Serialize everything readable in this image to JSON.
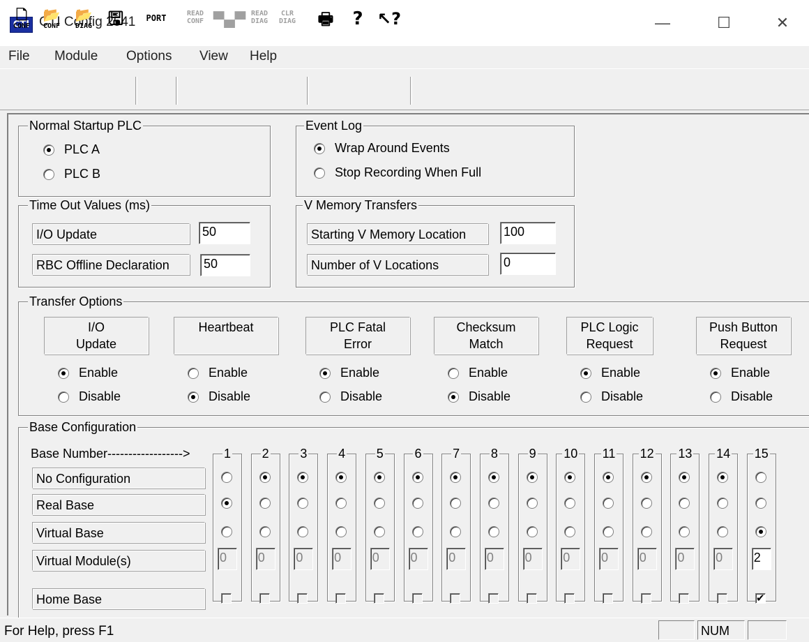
{
  "window": {
    "title": "CTI Config 2541",
    "icon_text": "CTI",
    "minimize": "—",
    "maximize": "☐",
    "close": "✕"
  },
  "menu": [
    "File",
    "Module",
    "Options",
    "View",
    "Help"
  ],
  "toolbar": {
    "new_conf": "CONF",
    "open_conf": "CONF",
    "open_diag": "DIAG",
    "port": "PORT",
    "read_conf": [
      "READ",
      "CONF"
    ],
    "read_diag": [
      "READ",
      "DIAG"
    ],
    "clr_diag": [
      "CLR",
      "DIAG"
    ]
  },
  "startup": {
    "title": "Normal Startup PLC",
    "options": [
      "PLC A",
      "PLC B"
    ],
    "selected": 0
  },
  "eventlog": {
    "title": "Event Log",
    "options": [
      "Wrap Around Events",
      "Stop Recording When Full"
    ],
    "selected": 0
  },
  "timeouts": {
    "title": "Time Out Values (ms)",
    "io_label": "I/O Update",
    "io_value": "50",
    "rbc_label": "RBC Offline Declaration",
    "rbc_value": "50"
  },
  "vmem": {
    "title": "V Memory Transfers",
    "start_label": "Starting V Memory Location",
    "start_value": "100",
    "count_label": "Number of V Locations",
    "count_value": "0"
  },
  "transfer": {
    "title": "Transfer Options",
    "enable": "Enable",
    "disable": "Disable",
    "options": [
      {
        "l1": "I/O",
        "l2": "Update",
        "enabled": true
      },
      {
        "l1": "Heartbeat",
        "l2": "",
        "enabled": false
      },
      {
        "l1": "PLC Fatal",
        "l2": "Error",
        "enabled": true
      },
      {
        "l1": "Checksum",
        "l2": "Match",
        "enabled": false
      },
      {
        "l1": "PLC Logic",
        "l2": "Request",
        "enabled": true
      },
      {
        "l1": "Push Button",
        "l2": "Request",
        "enabled": true
      }
    ]
  },
  "base": {
    "title": "Base Configuration",
    "header": "Base Number------------------>",
    "rows": [
      "No Configuration",
      "Real Base",
      "Virtual Base",
      "Virtual Module(s)",
      "Home Base"
    ],
    "columns": [
      {
        "n": "1",
        "sel": 1,
        "mods": "0",
        "home": false
      },
      {
        "n": "2",
        "sel": 0,
        "mods": "0",
        "home": false
      },
      {
        "n": "3",
        "sel": 0,
        "mods": "0",
        "home": false
      },
      {
        "n": "4",
        "sel": 0,
        "mods": "0",
        "home": false
      },
      {
        "n": "5",
        "sel": 0,
        "mods": "0",
        "home": false
      },
      {
        "n": "6",
        "sel": 0,
        "mods": "0",
        "home": false
      },
      {
        "n": "7",
        "sel": 0,
        "mods": "0",
        "home": false
      },
      {
        "n": "8",
        "sel": 0,
        "mods": "0",
        "home": false
      },
      {
        "n": "9",
        "sel": 0,
        "mods": "0",
        "home": false
      },
      {
        "n": "10",
        "sel": 0,
        "mods": "0",
        "home": false
      },
      {
        "n": "11",
        "sel": 0,
        "mods": "0",
        "home": false
      },
      {
        "n": "12",
        "sel": 0,
        "mods": "0",
        "home": false
      },
      {
        "n": "13",
        "sel": 0,
        "mods": "0",
        "home": false
      },
      {
        "n": "14",
        "sel": 0,
        "mods": "0",
        "home": false
      },
      {
        "n": "15",
        "sel": 2,
        "mods": "2",
        "home": true
      }
    ]
  },
  "status": {
    "help": "For Help, press F1",
    "num": "NUM"
  }
}
